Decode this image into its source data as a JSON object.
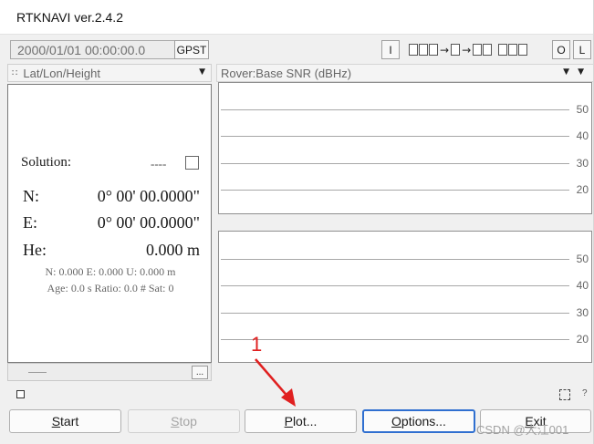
{
  "window": {
    "title": "RTKNAVI ver.2.4.2"
  },
  "toolbar": {
    "time": "2000/01/01 00:00:00.0",
    "time_system_label": "GPST",
    "input_button_label": "I",
    "output_button_label": "O",
    "log_button_label": "L",
    "stream_arrow": "→"
  },
  "left_panel": {
    "dropdown_label": "Lat/Lon/Height",
    "dropdown_icon": "grid-icon",
    "solution_label": "Solution:",
    "solution_status": "----",
    "lat_label": "N:",
    "lat_value": "0° 00' 00.0000\"",
    "lon_label": "E:",
    "lon_value": "0° 00' 00.0000\"",
    "height_label": "He:",
    "height_value": "0.000 m",
    "stats_line1": "N: 0.000 E: 0.000 U: 0.000 m",
    "stats_line2": "Age: 0.0 s Ratio: 0.0 # Sat: 0",
    "footer_button_label": "..."
  },
  "right_panel": {
    "dropdown_label": "Rover:Base SNR (dBHz)",
    "ticks": [
      "50",
      "40",
      "30",
      "20"
    ]
  },
  "buttons": {
    "start": {
      "label": "tart",
      "mnemonic": "S"
    },
    "stop": {
      "label": "top",
      "mnemonic": "S"
    },
    "plot": {
      "label": "lot...",
      "mnemonic": "P"
    },
    "options": {
      "label": "ptions...",
      "mnemonic": "O"
    },
    "exit": {
      "label": "xit",
      "mnemonic": "E"
    }
  },
  "annotation": {
    "number": "1",
    "color": "#e02020"
  },
  "watermark": "CSDN @大江001",
  "colors": {
    "focus_border": "#2f6fd0",
    "annotation_red": "#e02020"
  }
}
